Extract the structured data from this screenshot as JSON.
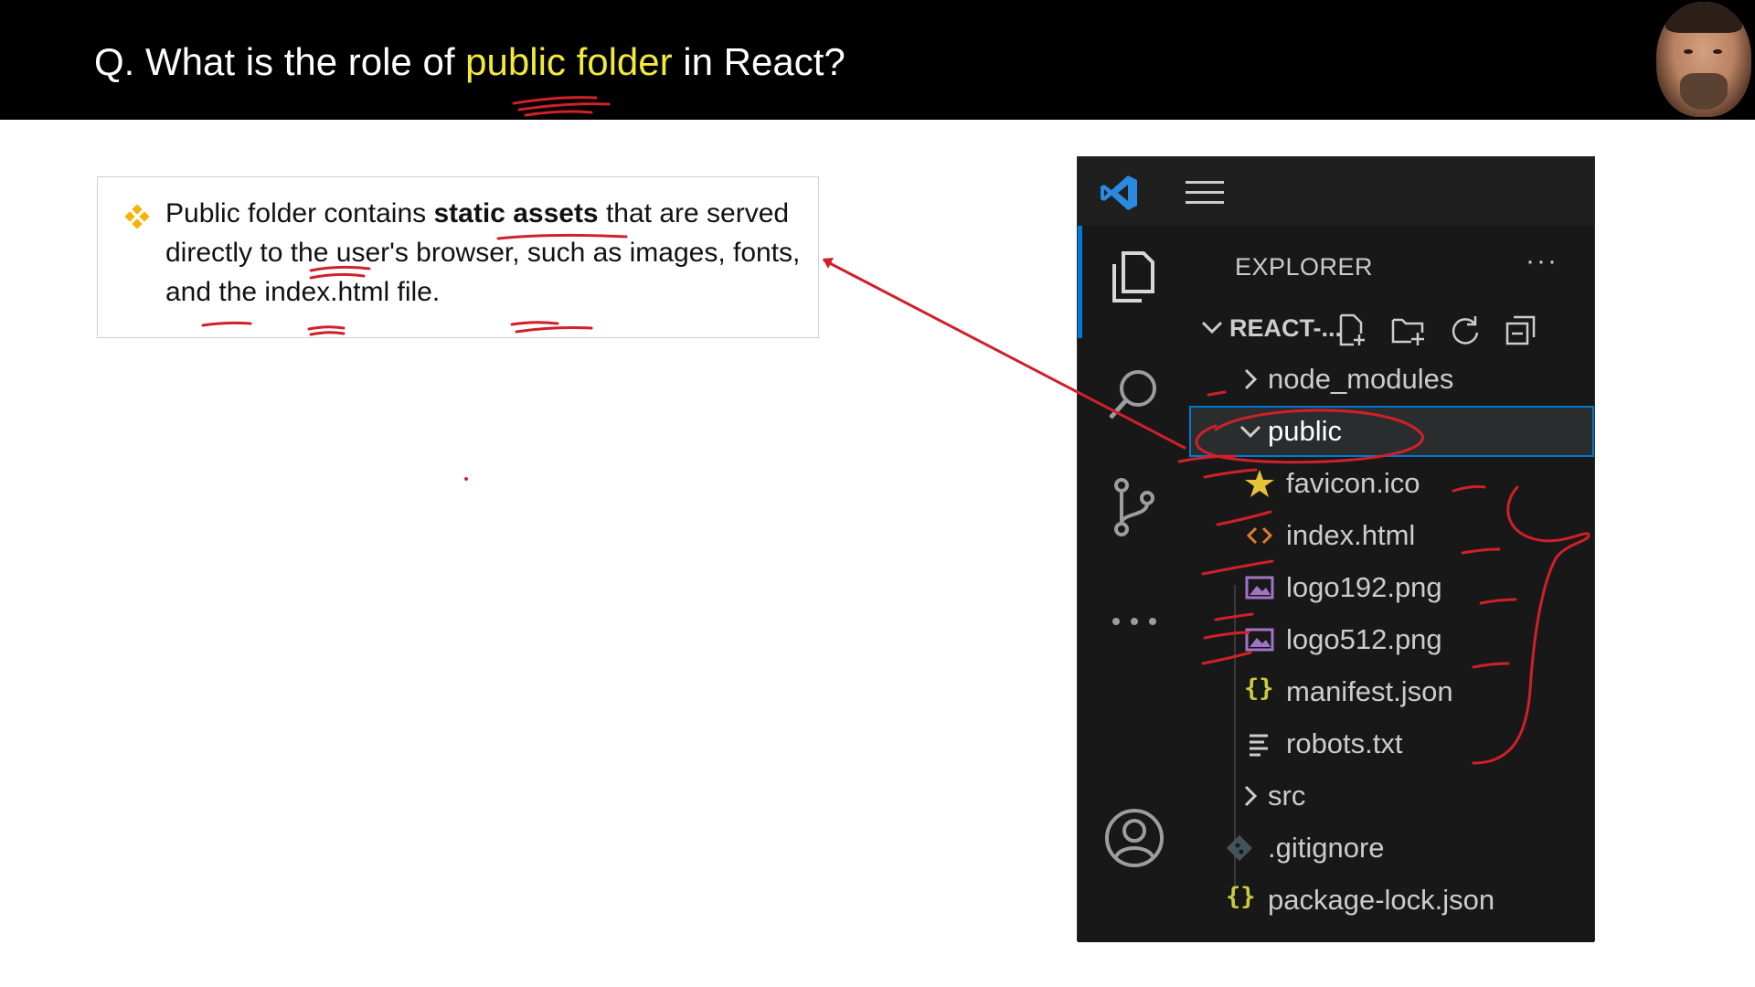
{
  "header": {
    "question_prefix": "Q. What is the role of ",
    "question_highlight": "public folder",
    "question_suffix": " in React?",
    "highlight_color": "#f2ea3a"
  },
  "definition": {
    "bullet_icon": "diamond-bullet-icon",
    "text_before": "Public folder contains ",
    "text_bold": "static assets",
    "text_after": " that are served directly to the user's browser, such as images, fonts, and the index.html file."
  },
  "vscode": {
    "logo_icon": "vscode-logo-icon",
    "menu_icon": "hamburger-menu-icon",
    "activity_bar": [
      {
        "name": "explorer",
        "icon": "files-icon",
        "active": true
      },
      {
        "name": "search",
        "icon": "search-icon"
      },
      {
        "name": "source-control",
        "icon": "source-control-icon"
      },
      {
        "name": "more",
        "icon": "ellipsis-icon"
      },
      {
        "name": "accounts",
        "icon": "account-icon"
      }
    ],
    "explorer": {
      "title": "EXPLORER",
      "more_label": "···",
      "project_name": "REACT-...",
      "toolbar": [
        "new-file-icon",
        "new-folder-icon",
        "refresh-icon",
        "collapse-all-icon"
      ],
      "tree": [
        {
          "label": "node_modules",
          "type": "folder",
          "expanded": false
        },
        {
          "label": "public",
          "type": "folder",
          "expanded": true,
          "selected": true
        },
        {
          "label": "favicon.ico",
          "type": "file",
          "icon": "star-icon"
        },
        {
          "label": "index.html",
          "type": "file",
          "icon": "html-icon"
        },
        {
          "label": "logo192.png",
          "type": "file",
          "icon": "image-icon"
        },
        {
          "label": "logo512.png",
          "type": "file",
          "icon": "image-icon"
        },
        {
          "label": "manifest.json",
          "type": "file",
          "icon": "json-icon"
        },
        {
          "label": "robots.txt",
          "type": "file",
          "icon": "text-file-icon"
        },
        {
          "label": "src",
          "type": "folder",
          "expanded": false
        },
        {
          "label": ".gitignore",
          "type": "file",
          "icon": "git-icon"
        },
        {
          "label": "package-lock.json",
          "type": "file",
          "icon": "json-icon"
        }
      ]
    }
  },
  "colors": {
    "accent": "#0078d4",
    "ink": "#d0202a",
    "json": "#cbcb41",
    "html": "#e37933",
    "image": "#a074c4",
    "star": "#e8c33a"
  }
}
